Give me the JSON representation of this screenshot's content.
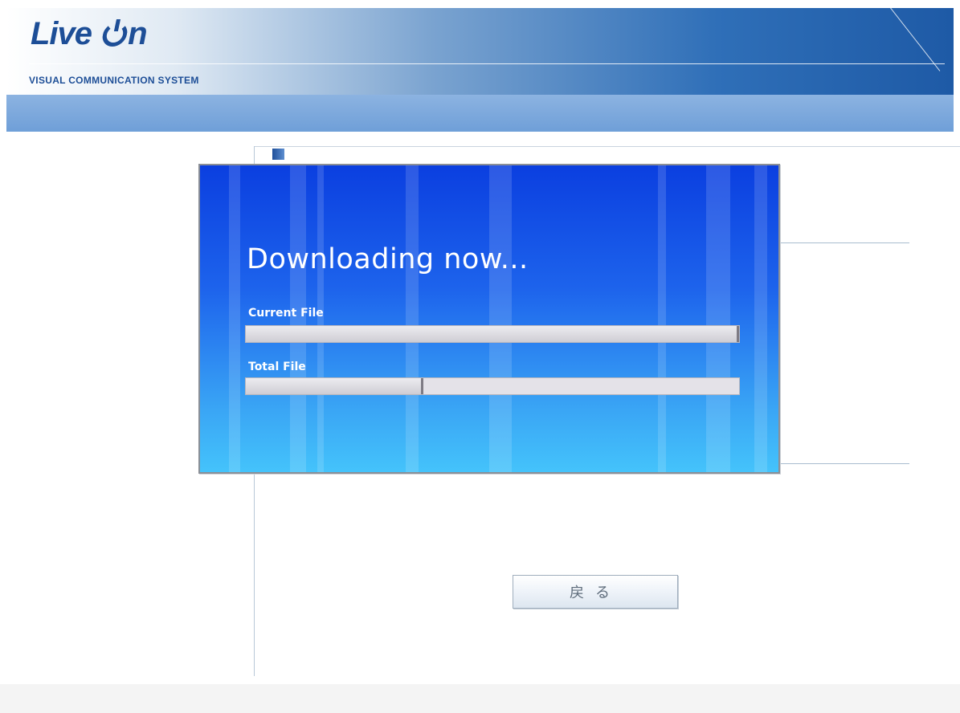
{
  "header": {
    "logo_text": "Live On",
    "subtitle": "VISUAL COMMUNICATION SYSTEM"
  },
  "dialog": {
    "title": "Downloading now...",
    "current_file_label": "Current File",
    "total_file_label": "Total File",
    "current_file_progress": 1.0,
    "total_file_progress": 0.36
  },
  "actions": {
    "back_label": "戻る"
  },
  "colors": {
    "brand_blue": "#1d4e97",
    "dialog_blue": "#1d63ec"
  },
  "icons": {
    "logo": "power-icon"
  }
}
